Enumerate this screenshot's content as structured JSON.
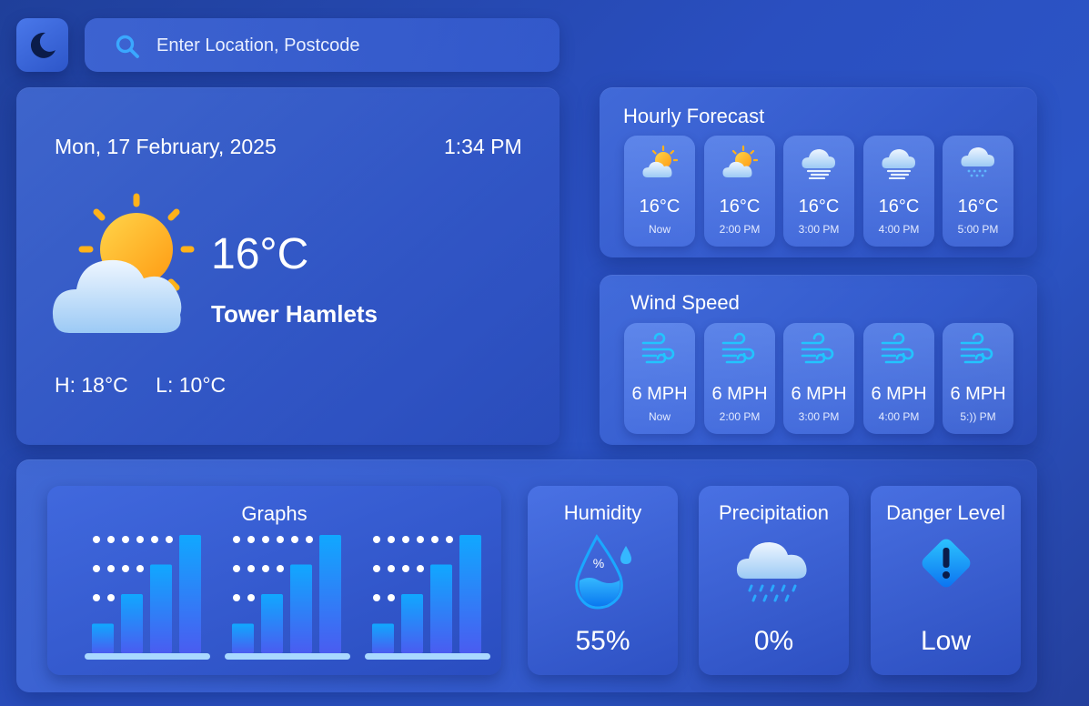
{
  "search": {
    "placeholder": "Enter Location, Postcode"
  },
  "current": {
    "date": "Mon, 17 February, 2025",
    "time": "1:34 PM",
    "temperature": "16°C",
    "location": "Tower Hamlets",
    "high": "H: 18°C",
    "low": "L: 10°C",
    "icon": "sun-cloud-icon"
  },
  "hourly": {
    "title": "Hourly Forecast",
    "items": [
      {
        "temp": "16°C",
        "time": "Now",
        "icon": "partly-sunny-icon"
      },
      {
        "temp": "16°C",
        "time": "2:00 PM",
        "icon": "partly-sunny-icon"
      },
      {
        "temp": "16°C",
        "time": "3:00 PM",
        "icon": "fog-cloud-icon"
      },
      {
        "temp": "16°C",
        "time": "4:00 PM",
        "icon": "fog-cloud-icon"
      },
      {
        "temp": "16°C",
        "time": "5:00 PM",
        "icon": "drizzle-cloud-icon"
      }
    ]
  },
  "wind": {
    "title": "Wind Speed",
    "items": [
      {
        "speed": "6 MPH",
        "time": "Now",
        "icon": "wind-icon"
      },
      {
        "speed": "6 MPH",
        "time": "2:00 PM",
        "icon": "wind-icon"
      },
      {
        "speed": "6 MPH",
        "time": "3:00 PM",
        "icon": "wind-icon"
      },
      {
        "speed": "6 MPH",
        "time": "4:00 PM",
        "icon": "wind-icon"
      },
      {
        "speed": "6 MPH",
        "time": "5:)) PM",
        "icon": "wind-icon"
      }
    ]
  },
  "graphs": {
    "title": "Graphs",
    "bar_levels": [
      0.25,
      0.5,
      0.75,
      1.0
    ]
  },
  "humidity": {
    "title": "Humidity",
    "value": "55%",
    "icon": "humidity-drop-icon"
  },
  "precipitation": {
    "title": "Precipitation",
    "value": "0%",
    "icon": "rain-cloud-icon"
  },
  "danger": {
    "title": "Danger Level",
    "value": "Low",
    "icon": "warning-diamond-icon"
  },
  "colors": {
    "accent": "#0a9cff",
    "sun": "#ffb21a",
    "cloud": "#cfe6ff",
    "bar_top": "#10a8ff",
    "bar_bottom": "#4a5cf0"
  }
}
